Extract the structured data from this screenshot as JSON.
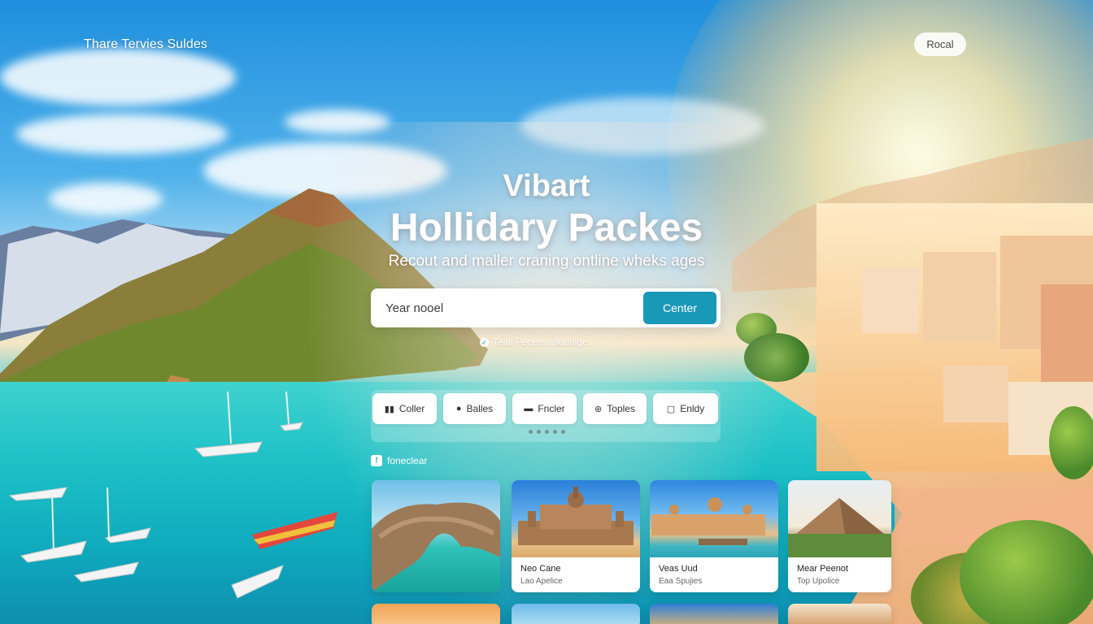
{
  "header": {
    "brand": "Thare Tervies Suldes",
    "top_button": "Rocal"
  },
  "hero": {
    "kicker": "Vibart",
    "title": "Hollidary Packes",
    "subtitle": "Recout and maller craning ontline wheks ages"
  },
  "search": {
    "placeholder": "Year nooel",
    "button": "Center",
    "hint": "Teall Fecess vikidinge."
  },
  "categories": [
    {
      "label": "Coller",
      "icon": "bar-chart-icon"
    },
    {
      "label": "Balles",
      "icon": "person-icon"
    },
    {
      "label": "Fncler",
      "icon": "card-icon"
    },
    {
      "label": "Toples",
      "icon": "tag-icon"
    },
    {
      "label": "Enldy",
      "icon": "chat-icon"
    }
  ],
  "section": {
    "label": "foneclear"
  },
  "cards": [
    {
      "title": "",
      "subtitle": ""
    },
    {
      "title": "Neo Cane",
      "subtitle": "Lao Apelice"
    },
    {
      "title": "Veas Uud",
      "subtitle": "Eaa Spujies"
    },
    {
      "title": "Mear Peenot",
      "subtitle": "Top Upolice"
    }
  ],
  "colors": {
    "accent": "#1a98b8",
    "text_on_image": "#ffffff"
  }
}
